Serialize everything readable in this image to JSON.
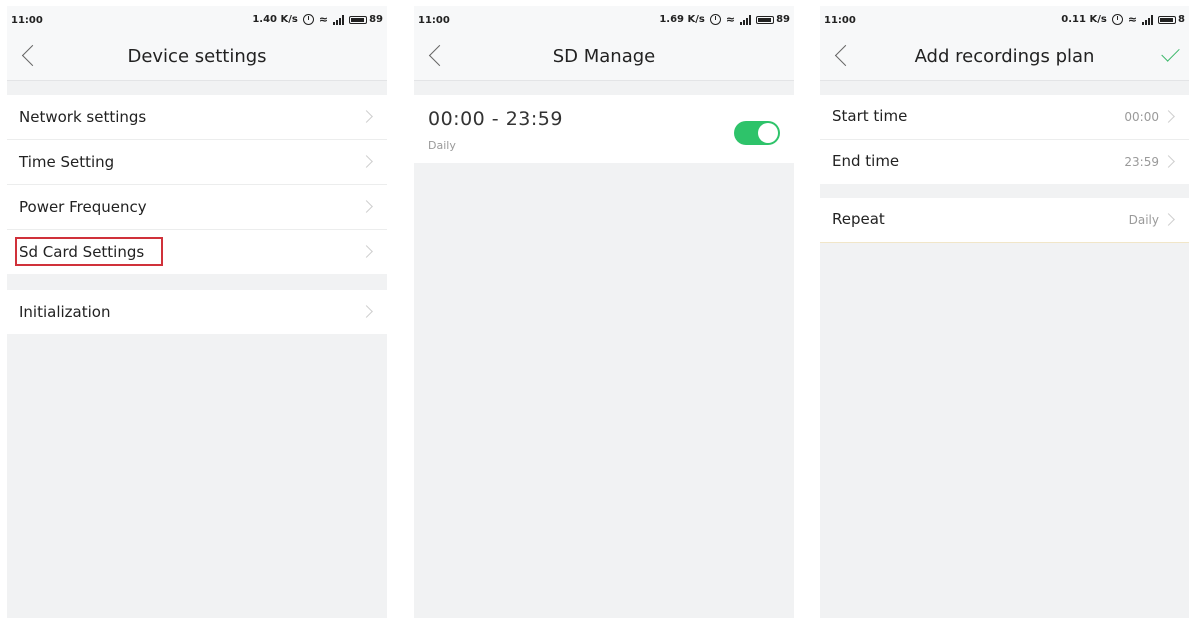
{
  "screens": [
    {
      "status": {
        "time": "11:00",
        "speed": "1.40 K/s",
        "battery": "89"
      },
      "title": "Device settings",
      "group1": [
        {
          "label": "Network settings"
        },
        {
          "label": "Time Setting"
        },
        {
          "label": "Power Frequency"
        },
        {
          "label": "Sd Card Settings",
          "highlighted": true
        }
      ],
      "group2": [
        {
          "label": "Initialization"
        }
      ]
    },
    {
      "status": {
        "time": "11:00",
        "speed": "1.69 K/s",
        "battery": "89"
      },
      "title": "SD Manage",
      "plan": {
        "range": "00:00 - 23:59",
        "repeat": "Daily",
        "enabled": true
      }
    },
    {
      "status": {
        "time": "11:00",
        "speed": "0.11 K/s",
        "battery": "8"
      },
      "title": "Add recordings plan",
      "group1": [
        {
          "label": "Start time",
          "value": "00:00"
        },
        {
          "label": "End time",
          "value": "23:59"
        }
      ],
      "group2": [
        {
          "label": "Repeat",
          "value": "Daily"
        }
      ]
    }
  ],
  "colors": {
    "accent_green": "#2ec36a",
    "highlight_red": "#d0313a",
    "background": "#f1f2f3"
  },
  "icons": [
    "back-chevron-icon",
    "alarm-icon",
    "wifi-icon",
    "signal-icon",
    "battery-icon",
    "row-chevron-icon",
    "confirm-check-icon"
  ]
}
